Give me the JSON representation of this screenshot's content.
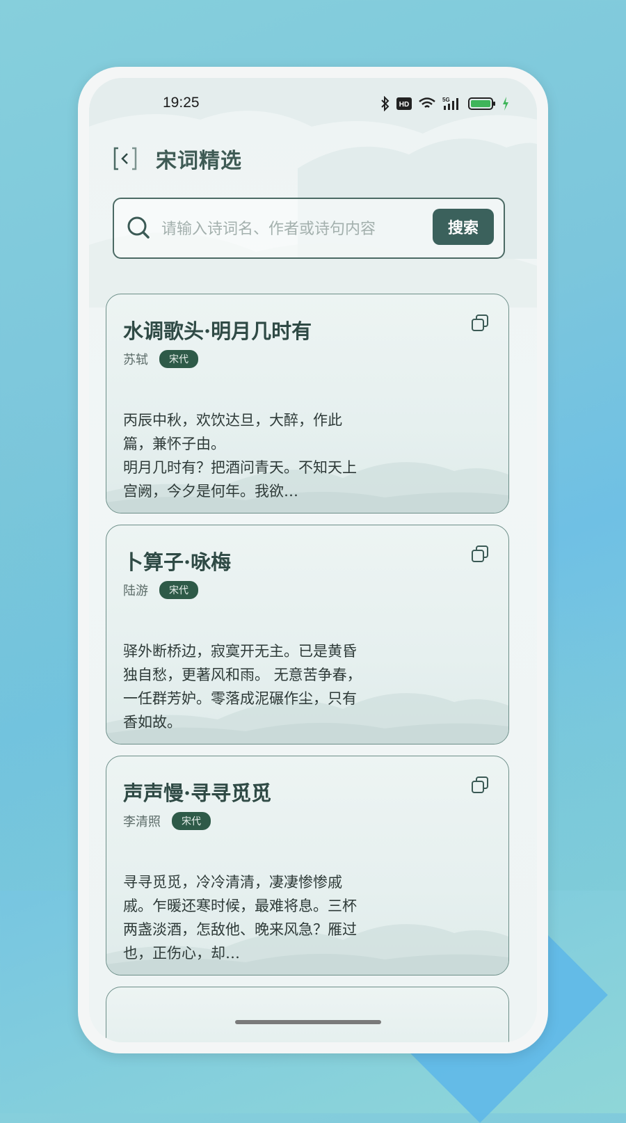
{
  "status_bar": {
    "time": "19:25",
    "icons": [
      "bluetooth-icon",
      "hd-icon",
      "wifi-icon",
      "5g-signal-icon",
      "battery-icon",
      "charging-icon"
    ],
    "network_label": "5G",
    "hd_label": "HD"
  },
  "header": {
    "back_icon": "back-chevron-icon",
    "title": "宋词精选"
  },
  "search": {
    "placeholder": "请输入诗词名、作者或诗句内容",
    "value": "",
    "button_label": "搜索"
  },
  "poems": [
    {
      "title": "水调歌头·明月几时有",
      "author": "苏轼",
      "dynasty": "宋代",
      "excerpt": "丙辰中秋，欢饮达旦，大醉，作此篇，兼怀子由。\n明月几时有？把酒问青天。不知天上宫阙，今夕是何年。我欲…"
    },
    {
      "title": "卜算子·咏梅",
      "author": "陆游",
      "dynasty": "宋代",
      "excerpt": "驿外断桥边，寂寞开无主。已是黄昏独自愁，更著风和雨。 无意苦争春，一任群芳妒。零落成泥碾作尘，只有香如故。"
    },
    {
      "title": "声声慢·寻寻觅觅",
      "author": "李清照",
      "dynasty": "宋代",
      "excerpt": "寻寻觅觅，冷冷清清，凄凄惨惨戚戚。乍暖还寒时候，最难将息。三杯两盏淡酒，怎敌他、晚来风急？雁过也，正伤心，却…"
    }
  ],
  "colors": {
    "accent": "#3b615c",
    "badge": "#2e5a48",
    "title_text": "#3e5a54"
  }
}
